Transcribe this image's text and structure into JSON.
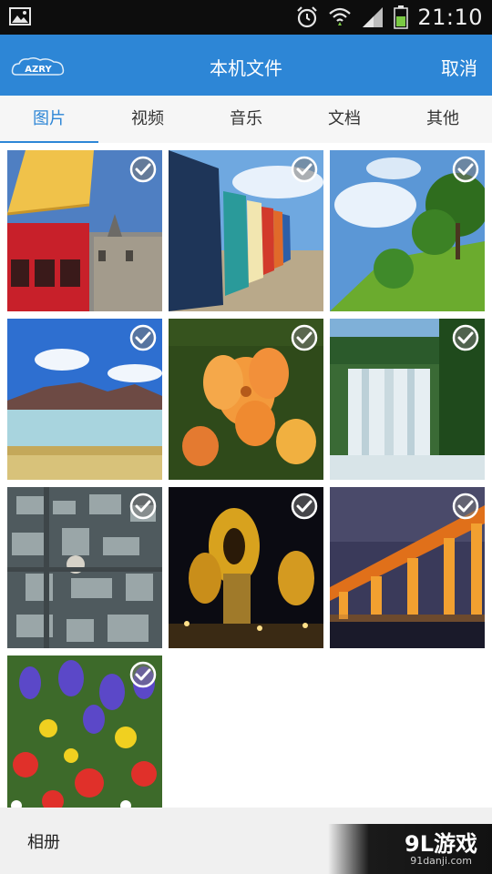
{
  "status_bar": {
    "time": "21:10",
    "icons": [
      "gallery-icon",
      "alarm-icon",
      "wifi-icon",
      "signal-icon",
      "battery-icon"
    ]
  },
  "header": {
    "logo_text": "AZRY",
    "title": "本机文件",
    "cancel_label": "取消"
  },
  "tabs": [
    {
      "label": "图片",
      "active": true
    },
    {
      "label": "视频",
      "active": false
    },
    {
      "label": "音乐",
      "active": false
    },
    {
      "label": "文档",
      "active": false
    },
    {
      "label": "其他",
      "active": false
    }
  ],
  "photos": [
    {
      "subject": "red bus and umbrella",
      "checked": false
    },
    {
      "subject": "beach huts",
      "checked": false
    },
    {
      "subject": "green hill with trees",
      "checked": false
    },
    {
      "subject": "lake and mountains",
      "checked": false
    },
    {
      "subject": "orange flowers",
      "checked": false
    },
    {
      "subject": "waterfall",
      "checked": false
    },
    {
      "subject": "city aerial",
      "checked": false
    },
    {
      "subject": "night buildings",
      "checked": false
    },
    {
      "subject": "bridge at night",
      "checked": false
    },
    {
      "subject": "flower bed",
      "checked": false
    }
  ],
  "footer": {
    "album_label": "相册"
  },
  "watermark": {
    "main": "9L游戏",
    "sub": "91danji.com"
  },
  "colors": {
    "accent": "#2d86d6",
    "status_bar": "#0d0d0d",
    "tab_bg": "#f6f6f6"
  }
}
